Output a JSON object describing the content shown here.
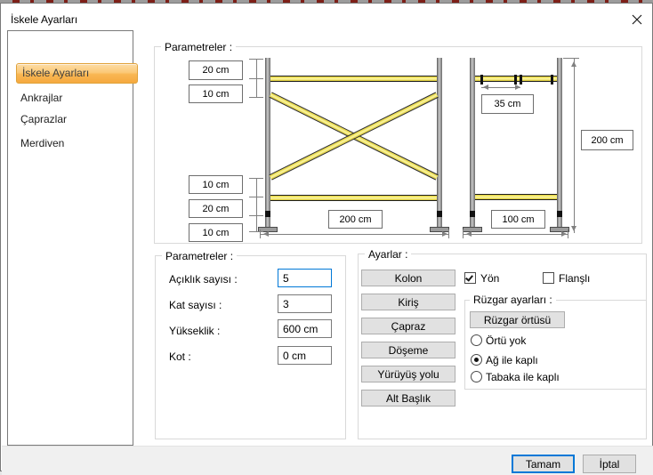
{
  "window": {
    "title": "İskele Ayarları"
  },
  "sidebar": {
    "items": [
      {
        "label": "İskele Ayarları",
        "selected": true
      },
      {
        "label": "Ankrajlar",
        "selected": false
      },
      {
        "label": "Çaprazlar",
        "selected": false
      },
      {
        "label": "Merdiven",
        "selected": false
      }
    ]
  },
  "diagram": {
    "group_label": "Parametreler :",
    "dims": {
      "top_offset": "20 cm",
      "top_gap": "10 cm",
      "bottom_gap": "10 cm",
      "bottom_offset": "20 cm",
      "base_offset": "10 cm",
      "bay_width": "200 cm",
      "coupler_spacing": "35 cm",
      "frame_height": "200 cm",
      "frame_width": "100 cm"
    }
  },
  "parameters": {
    "group_label": "Parametreler :",
    "fields": [
      {
        "label": "Açıklık sayısı :",
        "value": "5",
        "focused": true
      },
      {
        "label": "Kat sayısı :",
        "value": "3",
        "focused": false
      },
      {
        "label": "Yükseklik :",
        "value": "600 cm",
        "focused": false
      },
      {
        "label": "Kot :",
        "value": "0 cm",
        "focused": false
      }
    ]
  },
  "settings": {
    "group_label": "Ayarlar :",
    "buttons": [
      {
        "label": "Kolon"
      },
      {
        "label": "Kiriş"
      },
      {
        "label": "Çapraz"
      },
      {
        "label": "Döşeme"
      },
      {
        "label": "Yürüyüş yolu"
      },
      {
        "label": "Alt Başlık"
      }
    ],
    "checkboxes": [
      {
        "label": "Yön",
        "checked": true
      },
      {
        "label": "Flanşlı",
        "checked": false
      }
    ],
    "wind": {
      "group_label": "Rüzgar ayarları :",
      "button_label": "Rüzgar örtüsü",
      "radios": [
        {
          "label": "Örtü yok",
          "selected": false
        },
        {
          "label": "Ağ ile kaplı",
          "selected": true
        },
        {
          "label": "Tabaka ile kaplı",
          "selected": false
        }
      ]
    }
  },
  "footer": {
    "ok_label": "Tamam",
    "cancel_label": "İptal"
  },
  "colors": {
    "accent": "#0078d7",
    "selected_item_border": "#e0a23a",
    "rail_yellow": "#f0e040",
    "post_gray": "#8f8f8f",
    "footer_bg": "#f0f0f0"
  }
}
